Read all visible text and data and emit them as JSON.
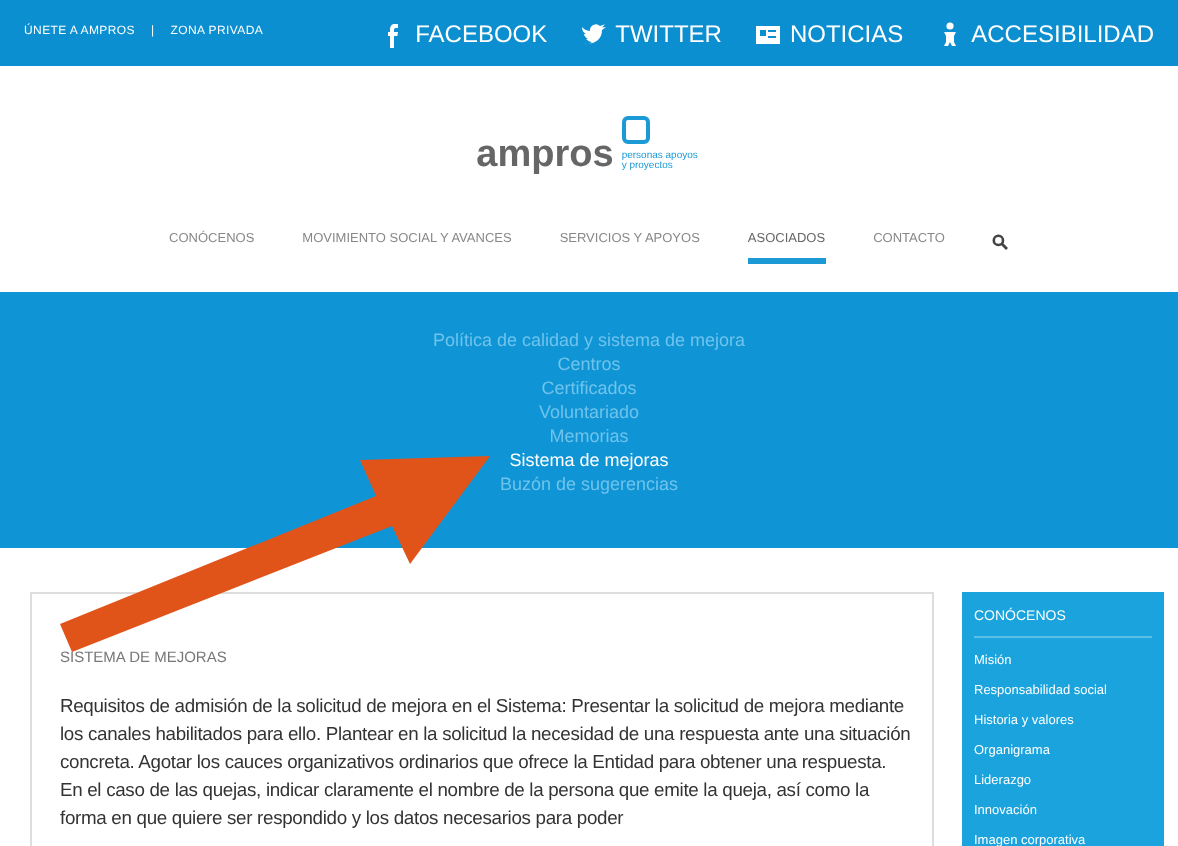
{
  "top_bar": {
    "left_links": [
      "ÚNETE A AMPROS",
      "ZONA PRIVADA"
    ],
    "separator": "|",
    "right_links": [
      {
        "kind": "facebook",
        "label": "FACEBOOK"
      },
      {
        "kind": "twitter",
        "label": "TWITTER"
      },
      {
        "kind": "news",
        "label": "NOTICIAS"
      },
      {
        "kind": "access",
        "label": "ACCESIBILIDAD"
      }
    ]
  },
  "logo": {
    "name": "ampros",
    "tagline": "personas apoyos y proyectos"
  },
  "nav": [
    {
      "label": "CONÓCENOS",
      "selected": false
    },
    {
      "label": "MOVIMIENTO SOCIAL Y AVANCES",
      "selected": false
    },
    {
      "label": "SERVICIOS Y APOYOS",
      "selected": false
    },
    {
      "label": "ASOCIADOS",
      "selected": true
    },
    {
      "label": "CONTACTO",
      "selected": false
    }
  ],
  "submenu": [
    {
      "label": "Política de calidad y sistema de mejora",
      "selected": false
    },
    {
      "label": "Centros",
      "selected": false
    },
    {
      "label": "Certificados",
      "selected": false
    },
    {
      "label": "Voluntariado",
      "selected": false
    },
    {
      "label": "Memorias",
      "selected": false
    },
    {
      "label": "Sistema de mejoras",
      "selected": true
    },
    {
      "label": "Buzón de sugerencias",
      "selected": false
    }
  ],
  "article": {
    "title": "SISTEMA DE MEJORAS",
    "body": "Requisitos de admisión de la solicitud de mejora en el Sistema: Presentar la solicitud de mejora mediante los canales habilitados para ello. Plantear en la solicitud la necesidad de una respuesta ante una situación concreta. Agotar los cauces organizativos ordinarios que ofrece la Entidad para obtener una respuesta. En el caso de las quejas, indicar claramente el nombre de la persona que emite la queja, así como la forma en que quiere ser respondido y los datos necesarios para poder"
  },
  "sidebar": {
    "title": "CONÓCENOS",
    "items": [
      "Misión",
      "Responsabilidad social",
      "Historia y valores",
      "Organigrama",
      "Liderazgo",
      "Innovación",
      "Imagen corporativa"
    ]
  }
}
